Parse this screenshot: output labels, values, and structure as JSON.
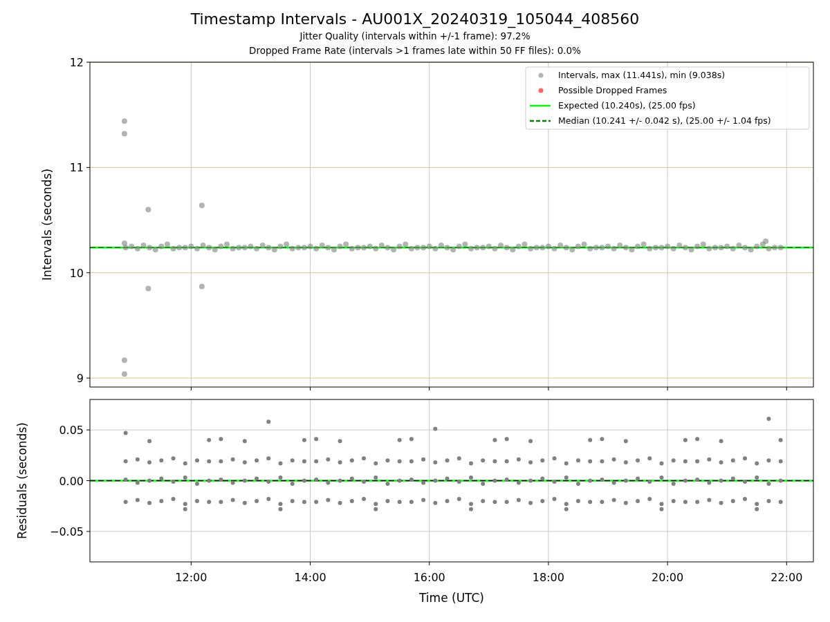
{
  "title": "Timestamp Intervals - AU001X_20240319_105044_408560",
  "subtitles": [
    "Jitter Quality (intervals within +/-1 frame): 97.2%",
    "Dropped Frame Rate (intervals >1 frames late within 50 FF files): 0.0%"
  ],
  "panels": [
    {
      "chart_data": {
        "type": "scatter",
        "ylabel": "Intervals (seconds)",
        "xlim": [
          10.3,
          22.45
        ],
        "ylim": [
          8.915,
          12
        ],
        "grid": true,
        "legend": "upper right",
        "yticks": [
          {
            "value": 9,
            "label": "9"
          },
          {
            "value": 10,
            "label": "10"
          },
          {
            "value": 11,
            "label": "11"
          },
          {
            "value": 12,
            "label": "12"
          }
        ],
        "x": [
          10.88,
          10.88,
          10.88,
          10.88,
          10.88,
          11.28,
          11.28,
          12.18,
          12.18,
          21.65,
          10.9,
          11.0,
          11.1,
          11.2,
          11.3,
          11.4,
          11.5,
          11.6,
          11.7,
          11.8,
          11.9,
          12.0,
          12.1,
          12.2,
          12.3,
          12.4,
          12.5,
          12.6,
          12.7,
          12.8,
          12.9,
          13.0,
          13.1,
          13.2,
          13.3,
          13.4,
          13.5,
          13.6,
          13.7,
          13.8,
          13.9,
          14.0,
          14.1,
          14.2,
          14.3,
          14.4,
          14.5,
          14.6,
          14.7,
          14.8,
          14.9,
          15.0,
          15.1,
          15.2,
          15.3,
          15.4,
          15.5,
          15.6,
          15.7,
          15.8,
          15.9,
          16.0,
          16.1,
          16.2,
          16.3,
          16.4,
          16.5,
          16.6,
          16.7,
          16.8,
          16.9,
          17.0,
          17.1,
          17.2,
          17.3,
          17.4,
          17.5,
          17.6,
          17.7,
          17.8,
          17.9,
          18.0,
          18.1,
          18.2,
          18.3,
          18.4,
          18.5,
          18.6,
          18.7,
          18.8,
          18.9,
          19.0,
          19.1,
          19.2,
          19.3,
          19.4,
          19.5,
          19.6,
          19.7,
          19.8,
          19.9,
          20.0,
          20.1,
          20.2,
          20.3,
          20.4,
          20.5,
          20.6,
          20.7,
          20.8,
          20.9,
          21.0,
          21.1,
          21.2,
          21.3,
          21.4,
          21.5,
          21.6,
          21.7,
          21.8,
          21.9
        ],
        "series": [
          {
            "name": "Intervals, max (11.441s), min (9.038s)",
            "color": "#808080",
            "values": [
              11.441,
              11.32,
              10.28,
              9.17,
              9.038,
              10.6,
              9.85,
              10.64,
              9.87,
              10.3,
              10.24,
              10.25,
              10.23,
              10.26,
              10.24,
              10.22,
              10.25,
              10.27,
              10.23,
              10.24,
              10.24,
              10.25,
              10.23,
              10.26,
              10.24,
              10.22,
              10.25,
              10.27,
              10.23,
              10.24,
              10.24,
              10.25,
              10.23,
              10.26,
              10.24,
              10.22,
              10.25,
              10.27,
              10.23,
              10.24,
              10.24,
              10.25,
              10.23,
              10.26,
              10.24,
              10.22,
              10.25,
              10.27,
              10.23,
              10.24,
              10.24,
              10.25,
              10.23,
              10.26,
              10.24,
              10.22,
              10.25,
              10.27,
              10.23,
              10.24,
              10.24,
              10.25,
              10.23,
              10.26,
              10.24,
              10.22,
              10.25,
              10.27,
              10.23,
              10.24,
              10.24,
              10.25,
              10.23,
              10.26,
              10.24,
              10.22,
              10.25,
              10.27,
              10.23,
              10.24,
              10.24,
              10.25,
              10.23,
              10.26,
              10.24,
              10.22,
              10.25,
              10.27,
              10.23,
              10.24,
              10.24,
              10.25,
              10.23,
              10.26,
              10.24,
              10.22,
              10.25,
              10.27,
              10.23,
              10.24,
              10.24,
              10.25,
              10.23,
              10.26,
              10.24,
              10.22,
              10.25,
              10.27,
              10.23,
              10.24,
              10.24,
              10.25,
              10.23,
              10.26,
              10.24,
              10.22,
              10.25,
              10.27,
              10.23,
              10.24,
              10.24
            ]
          },
          {
            "name": "Possible Dropped Frames",
            "color": "#ff0000",
            "values": [
              null,
              null,
              null,
              null,
              null,
              null,
              null,
              null,
              null,
              null,
              null,
              null,
              null,
              null,
              null,
              null,
              null,
              null,
              null,
              null,
              null,
              null,
              null,
              null,
              null,
              null,
              null,
              null,
              null,
              null,
              null,
              null,
              null,
              null,
              null,
              null,
              null,
              null,
              null,
              null,
              null,
              null,
              null,
              null,
              null,
              null,
              null,
              null,
              null,
              null,
              null,
              null,
              null,
              null,
              null,
              null,
              null,
              null,
              null,
              null,
              null,
              null,
              null,
              null,
              null,
              null,
              null,
              null,
              null,
              null,
              null,
              null,
              null,
              null,
              null,
              null,
              null,
              null,
              null,
              null,
              null,
              null,
              null,
              null,
              null,
              null,
              null,
              null,
              null,
              null,
              null,
              null,
              null,
              null,
              null,
              null,
              null,
              null,
              null,
              null,
              null,
              null,
              null,
              null,
              null,
              null,
              null,
              null,
              null,
              null,
              null,
              null,
              null,
              null,
              null,
              null,
              null,
              null,
              null,
              null,
              null
            ]
          }
        ],
        "ref_lines": [
          {
            "axis": "y",
            "value": 10.24,
            "label": "Expected (10.240s), (25.00 fps)",
            "color": "#00ff00"
          },
          {
            "axis": "y",
            "value": 10.241,
            "label": "Median (10.241 +/- 0.042 s), (25.00 +/- 1.04 fps)",
            "color": "#008000"
          }
        ]
      }
    },
    {
      "chart_data": {
        "type": "scatter",
        "xlabel": "Time (UTC)",
        "ylabel": "Residuals (seconds)",
        "xlim": [
          10.3,
          22.45
        ],
        "ylim": [
          -0.08,
          0.08
        ],
        "grid": true,
        "xticks": [
          {
            "value": 12,
            "label": "12:00"
          },
          {
            "value": 14,
            "label": "14:00"
          },
          {
            "value": 16,
            "label": "16:00"
          },
          {
            "value": 18,
            "label": "18:00"
          },
          {
            "value": 20,
            "label": "20:00"
          },
          {
            "value": 22,
            "label": "22:00"
          }
        ],
        "yticks": [
          {
            "value": -0.05,
            "label": "−0.05"
          },
          {
            "value": 0,
            "label": "0.00"
          },
          {
            "value": 0.05,
            "label": "0.05"
          }
        ],
        "x": [
          10.9,
          11.1,
          11.3,
          11.5,
          11.7,
          11.9,
          12.1,
          12.3,
          12.5,
          12.7,
          12.9,
          13.1,
          13.3,
          13.5,
          13.7,
          13.9,
          14.1,
          14.3,
          14.5,
          14.7,
          14.9,
          15.1,
          15.3,
          15.5,
          15.7,
          15.9,
          16.1,
          16.3,
          16.5,
          16.7,
          16.9,
          17.1,
          17.3,
          17.5,
          17.7,
          17.9,
          18.1,
          18.3,
          18.5,
          18.7,
          18.9,
          19.1,
          19.3,
          19.5,
          19.7,
          19.9,
          20.1,
          20.3,
          20.5,
          20.7,
          20.9,
          21.1,
          21.3,
          21.5,
          21.7,
          21.9
        ],
        "series": [
          {
            "color": "#808080",
            "values": [
              0.019,
              0.021,
              0.018,
              0.02,
              0.022,
              0.017,
              0.02,
              0.019,
              0.019,
              0.021,
              0.018,
              0.02,
              0.022,
              0.017,
              0.02,
              0.019,
              0.019,
              0.021,
              0.018,
              0.02,
              0.022,
              0.017,
              0.02,
              0.019,
              0.019,
              0.021,
              0.018,
              0.02,
              0.022,
              0.017,
              0.02,
              0.019,
              0.019,
              0.021,
              0.018,
              0.02,
              0.022,
              0.017,
              0.02,
              0.019,
              0.019,
              0.021,
              0.018,
              0.02,
              0.022,
              0.017,
              0.02,
              0.019,
              0.019,
              0.021,
              0.018,
              0.02,
              0.022,
              0.017,
              0.02,
              0.019
            ]
          },
          {
            "color": "#808080",
            "values": [
              0.001,
              -0.002,
              0.0,
              0.002,
              -0.001,
              0.003,
              -0.003,
              0.0,
              0.001,
              -0.002,
              0.0,
              0.002,
              -0.001,
              0.003,
              -0.003,
              0.0,
              0.001,
              -0.002,
              0.0,
              0.002,
              -0.001,
              0.003,
              -0.003,
              0.0,
              0.001,
              -0.002,
              0.0,
              0.002,
              -0.001,
              0.003,
              -0.003,
              0.0,
              0.001,
              -0.002,
              0.0,
              0.002,
              -0.001,
              0.003,
              -0.003,
              0.0,
              0.001,
              -0.002,
              0.0,
              0.002,
              -0.001,
              0.003,
              -0.003,
              0.0,
              0.001,
              -0.002,
              0.0,
              0.002,
              -0.001,
              0.003,
              -0.003,
              0.0
            ]
          },
          {
            "color": "#808080",
            "values": [
              -0.021,
              -0.019,
              -0.022,
              -0.02,
              -0.018,
              -0.023,
              -0.02,
              -0.021,
              -0.021,
              -0.019,
              -0.022,
              -0.02,
              -0.018,
              -0.023,
              -0.02,
              -0.021,
              -0.021,
              -0.019,
              -0.022,
              -0.02,
              -0.018,
              -0.023,
              -0.02,
              -0.021,
              -0.021,
              -0.019,
              -0.022,
              -0.02,
              -0.018,
              -0.023,
              -0.02,
              -0.021,
              -0.021,
              -0.019,
              -0.022,
              -0.02,
              -0.018,
              -0.023,
              -0.02,
              -0.021,
              -0.021,
              -0.019,
              -0.022,
              -0.02,
              -0.018,
              -0.023,
              -0.02,
              -0.021,
              -0.021,
              -0.019,
              -0.022,
              -0.02,
              -0.018,
              -0.023,
              -0.02,
              -0.021
            ]
          },
          {
            "color": "#808080",
            "values": [
              0.047,
              null,
              0.039,
              null,
              null,
              -0.028,
              null,
              0.04,
              0.041,
              null,
              0.039,
              null,
              0.058,
              -0.028,
              null,
              0.04,
              0.041,
              null,
              0.039,
              null,
              null,
              -0.028,
              null,
              0.04,
              0.041,
              null,
              0.051,
              null,
              null,
              -0.028,
              null,
              0.04,
              0.041,
              null,
              0.039,
              null,
              null,
              -0.028,
              null,
              0.04,
              0.041,
              null,
              0.039,
              null,
              null,
              -0.028,
              null,
              0.04,
              0.041,
              null,
              0.039,
              null,
              null,
              -0.028,
              0.061,
              0.04
            ]
          }
        ],
        "ref_lines": [
          {
            "axis": "y",
            "value": 0,
            "color": "#00ff00"
          },
          {
            "axis": "y",
            "value": 0,
            "color": "#000000"
          }
        ]
      }
    }
  ]
}
